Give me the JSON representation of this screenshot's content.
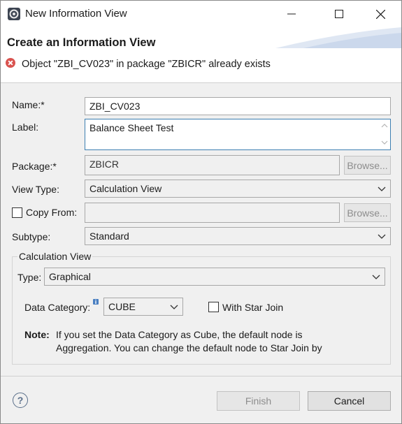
{
  "window": {
    "title": "New Information View"
  },
  "header": {
    "title": "Create an Information View",
    "error_message": "Object \"ZBI_CV023\" in package \"ZBICR\" already exists"
  },
  "form": {
    "name_label": "Name:*",
    "name_value": "ZBI_CV023",
    "label_label": "Label:",
    "label_value": "Balance Sheet Test",
    "package_label": "Package:*",
    "package_value": "ZBICR",
    "browse_label": "Browse...",
    "view_type_label": "View Type:",
    "view_type_value": "Calculation View",
    "copy_from_label": "Copy From:",
    "copy_from_value": "",
    "copy_from_checked": false,
    "subtype_label": "Subtype:",
    "subtype_value": "Standard"
  },
  "calc_group": {
    "title": "Calculation View",
    "type_label": "Type:",
    "type_value": "Graphical",
    "data_category_label": "Data Category:",
    "data_category_value": "CUBE",
    "with_star_join_label": "With Star Join",
    "with_star_join_checked": false,
    "note_label": "Note:",
    "note_text_line1": "If you set the Data Category as Cube, the default node is",
    "note_text_line2": "Aggregation. You can change the default node to Star Join by"
  },
  "footer": {
    "help_glyph": "?",
    "finish_label": "Finish",
    "cancel_label": "Cancel"
  },
  "colors": {
    "error": "#d9534f",
    "accent_swoosh": "#c9d6ea"
  }
}
